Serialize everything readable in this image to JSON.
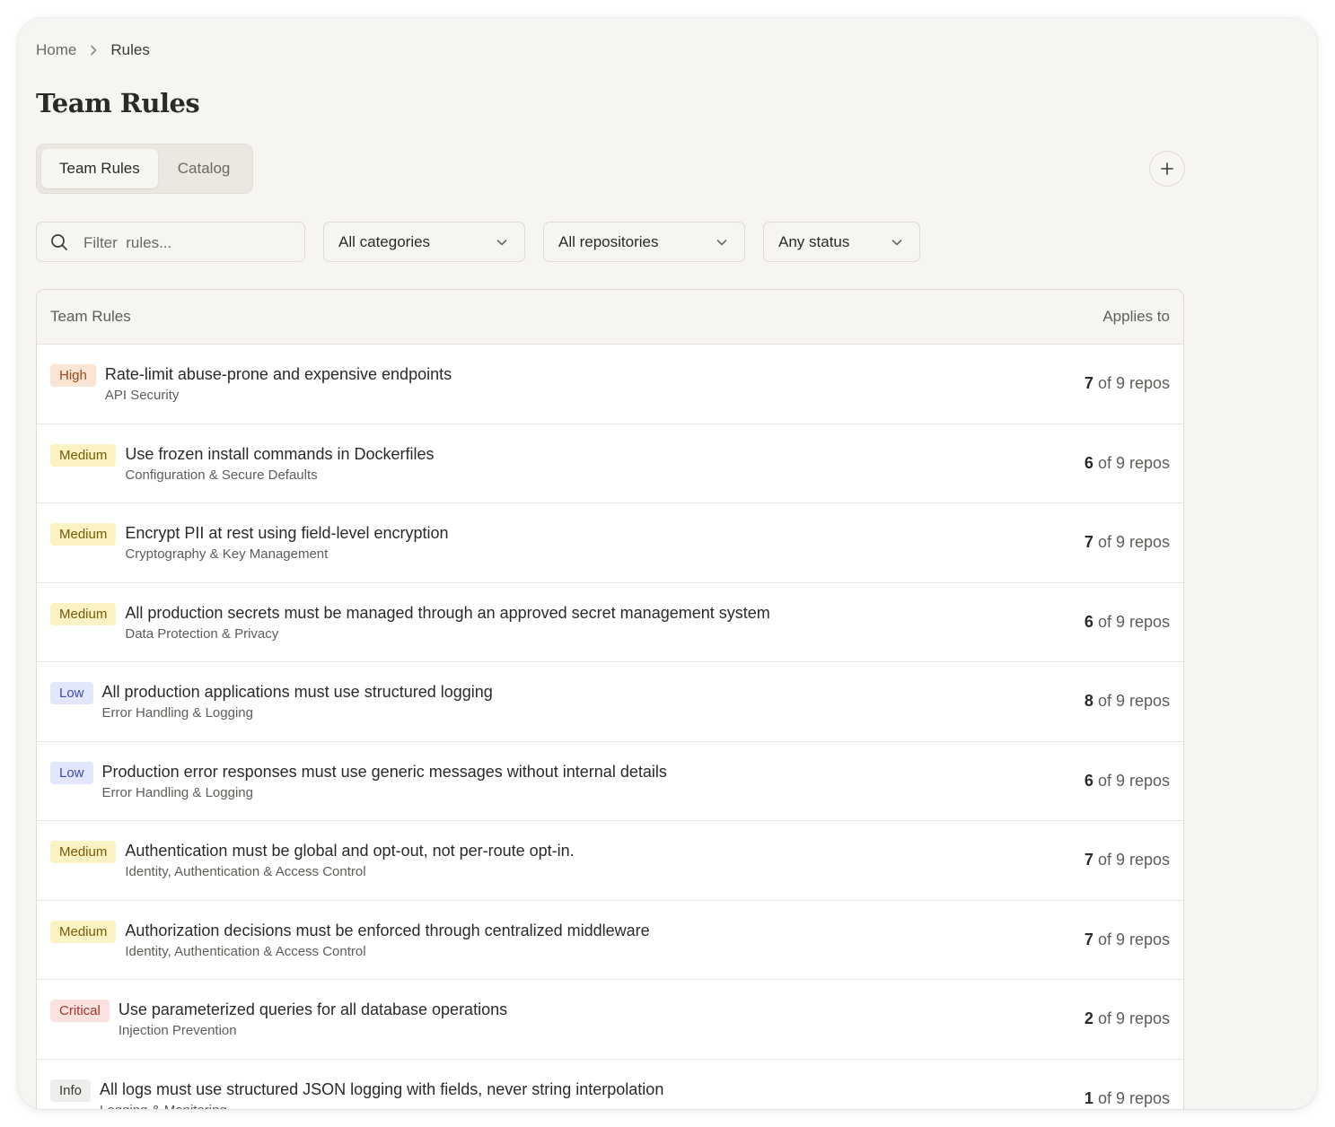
{
  "breadcrumb": {
    "home": "Home",
    "current": "Rules"
  },
  "page": {
    "title": "Team Rules"
  },
  "tabs": [
    {
      "label": "Team Rules",
      "active": true
    },
    {
      "label": "Catalog",
      "active": false
    }
  ],
  "add_button": {
    "icon": "plus-icon"
  },
  "filters": {
    "search_placeholder": "Filter  rules...",
    "search_value": "",
    "category": "All categories",
    "repository": "All repositories",
    "status": "Any status"
  },
  "table": {
    "header_left": "Team Rules",
    "header_right": "Applies to",
    "repos_suffix": "of 9 repos",
    "rows": [
      {
        "severity": "High",
        "title": "Rate-limit abuse-prone and expensive endpoints",
        "category": "API Security",
        "applies_count": "7"
      },
      {
        "severity": "Medium",
        "title": "Use frozen install commands in Dockerfiles",
        "category": "Configuration & Secure Defaults",
        "applies_count": "6"
      },
      {
        "severity": "Medium",
        "title": "Encrypt PII at rest using field-level encryption",
        "category": "Cryptography & Key Management",
        "applies_count": "7"
      },
      {
        "severity": "Medium",
        "title": "All production secrets must be managed through an approved secret management system",
        "category": "Data Protection & Privacy",
        "applies_count": "6"
      },
      {
        "severity": "Low",
        "title": "All production applications must use structured logging",
        "category": "Error Handling & Logging",
        "applies_count": "8"
      },
      {
        "severity": "Low",
        "title": "Production error responses must use generic messages without internal details",
        "category": "Error Handling & Logging",
        "applies_count": "6"
      },
      {
        "severity": "Medium",
        "title": "Authentication must be global and opt-out, not per-route opt-in.",
        "category": "Identity, Authentication & Access Control",
        "applies_count": "7"
      },
      {
        "severity": "Medium",
        "title": "Authorization decisions must be enforced through centralized middleware",
        "category": "Identity, Authentication & Access Control",
        "applies_count": "7"
      },
      {
        "severity": "Critical",
        "title": "Use parameterized queries for all database operations",
        "category": "Injection Prevention",
        "applies_count": "2"
      },
      {
        "severity": "Info",
        "title": "All logs must use structured JSON logging with fields, never string interpolation",
        "category": "Logging & Monitoring",
        "applies_count": "1"
      }
    ]
  },
  "colors": {
    "background": "#f6f5f1",
    "high": "#f9e5d3",
    "medium": "#fbf3c4",
    "low": "#e3e7fb",
    "critical": "#fbe2e0",
    "info": "#efeeec"
  }
}
